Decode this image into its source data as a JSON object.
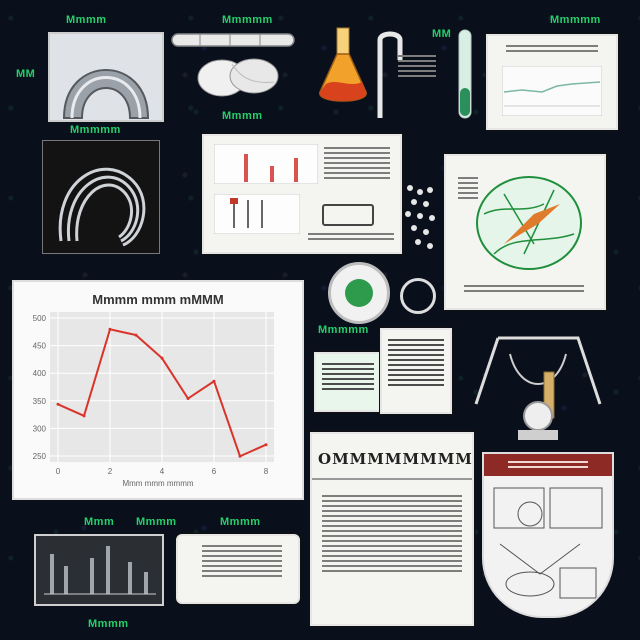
{
  "labels": {
    "top_left": "Mmmm",
    "top_mid": "Mmmmm",
    "top_right": "Mmmmm",
    "under_arch": "Mmmmm",
    "under_belt": "Mmmm",
    "mid_left": "Mmmmm",
    "bottom_left_a": "Mmm",
    "bottom_left_b": "Mmmm",
    "bottom_mid": "Mmmm",
    "bottom_row": "Mmmm",
    "side_a": "MM",
    "side_b": "MM"
  },
  "chart_data": {
    "type": "line",
    "title": "Mmmm mmm mMMM",
    "xlabel": "Mmm mmm mmmm",
    "ylabel": "",
    "x": [
      0,
      1,
      2,
      3,
      4,
      5,
      6,
      7,
      8
    ],
    "values": [
      340,
      320,
      470,
      460,
      420,
      350,
      380,
      250,
      270
    ],
    "ylim": [
      240,
      500
    ],
    "y_ticks": [
      "500",
      "450",
      "400",
      "350",
      "300",
      "250"
    ],
    "x_ticks": [
      "0",
      "2",
      "4",
      "6",
      "8"
    ],
    "line_color": "#d9342b",
    "grid": true
  },
  "document": {
    "heading": "OMMMMMMMM"
  },
  "colors": {
    "accent_green": "#25d06a",
    "background": "#0a0f1c",
    "paper": "#f4f4f1",
    "flask": "#f2a12a",
    "line": "#d9342b"
  }
}
